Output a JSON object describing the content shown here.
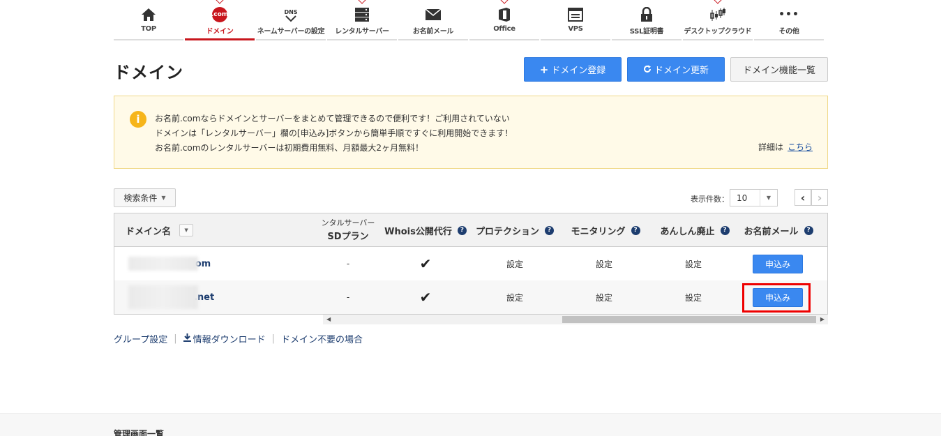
{
  "nav": [
    {
      "label": "TOP",
      "icon": "home-icon"
    },
    {
      "label": "ドメイン",
      "icon": "com-icon",
      "icon_text": ".com"
    },
    {
      "label": "ネームサーバーの設定",
      "icon": "dns-icon",
      "icon_text": "DNS"
    },
    {
      "label": "レンタルサーバー",
      "icon": "server-icon"
    },
    {
      "label": "お名前メール",
      "icon": "mail-icon"
    },
    {
      "label": "Office",
      "icon": "office-icon"
    },
    {
      "label": "VPS",
      "icon": "vps-icon"
    },
    {
      "label": "SSL証明書",
      "icon": "lock-icon"
    },
    {
      "label": "デスクトップクラウド",
      "icon": "chart-icon"
    },
    {
      "label": "その他",
      "icon": "more-icon",
      "icon_text": "•••"
    }
  ],
  "page": {
    "title": "ドメイン",
    "buttons": {
      "register": "ドメイン登録",
      "renew": "ドメイン更新",
      "features": "ドメイン機能一覧"
    }
  },
  "info": {
    "icon_text": "i",
    "line1": "お名前.comならドメインとサーバーをまとめて管理できるので便利です！ご利用されていない",
    "line2": "ドメインは「レンタルサーバー」欄の[申込み]ボタンから簡単手順ですぐに利用開始できます！",
    "line3": "お名前.comのレンタルサーバーは初期費用無料、月額最大2ヶ月無料！",
    "detail_prefix": "詳細は",
    "detail_link": "こちら"
  },
  "controls": {
    "search": "検索条件",
    "perpage_label": "表示件数：",
    "perpage_value": "10",
    "prev": "‹",
    "next": "›"
  },
  "table": {
    "headers": {
      "domain": "ドメイン名",
      "rental_l1": "ンタルサーバー",
      "rental_l2": "SDプラン",
      "whois": "Whois公開代行",
      "protection": "プロテクション",
      "monitoring": "モニタリング",
      "anshin": "あんしん廃止",
      "mail": "お名前メール"
    },
    "rows": [
      {
        "domain": "com",
        "rental": "-",
        "whois": "✔",
        "protection": "設定",
        "monitoring": "設定",
        "anshin": "設定",
        "mail": "申込み"
      },
      {
        "domain": ").net",
        "rental": "-",
        "whois": "✔",
        "protection": "設定",
        "monitoring": "設定",
        "anshin": "設定",
        "mail": "申込み"
      }
    ]
  },
  "links": {
    "group": "グループ設定",
    "download": "情報ダウンロード",
    "unneeded": "ドメイン不要の場合"
  },
  "footer": {
    "title": "管理画面一覧"
  },
  "colors": {
    "accent_red": "#c8161d",
    "button_blue": "#3a88f0",
    "info_bg": "#fffae8",
    "info_icon": "#f6b51b",
    "highlight": "#ee0000"
  }
}
